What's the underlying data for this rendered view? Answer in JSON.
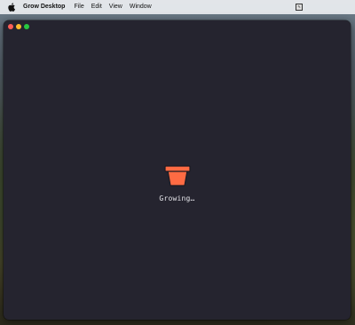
{
  "menubar": {
    "apple_icon": "apple-icon",
    "app_name": "Grow Desktop",
    "items": [
      "File",
      "Edit",
      "View",
      "Window"
    ],
    "status_icon": "input-menu-icon"
  },
  "window": {
    "background": "#25242f",
    "traffic_lights": {
      "close": "#ff5f57",
      "minimize": "#febc2e",
      "zoom": "#28c840"
    },
    "loader": {
      "icon": "flower-pot-icon",
      "icon_color": "#ff6b43",
      "text": "Growing…"
    }
  }
}
